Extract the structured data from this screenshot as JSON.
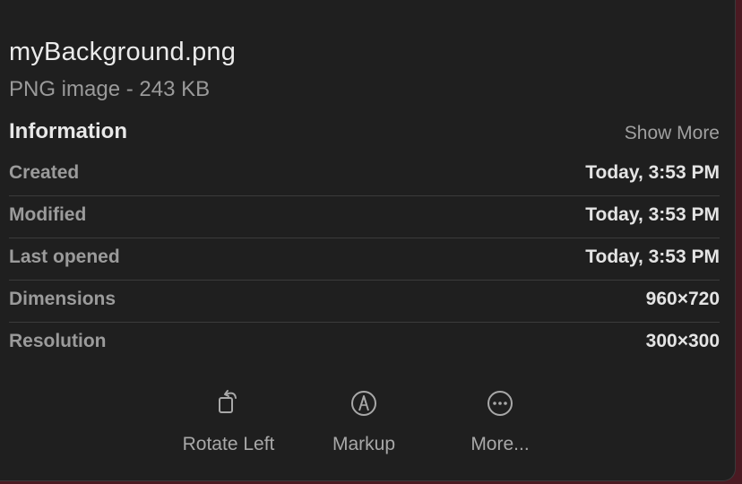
{
  "file": {
    "name": "myBackground.png",
    "kind": "PNG image - 243 KB"
  },
  "information": {
    "title": "Information",
    "show_more_label": "Show More",
    "rows": [
      {
        "label": "Created",
        "value": "Today, 3:53 PM"
      },
      {
        "label": "Modified",
        "value": "Today, 3:53 PM"
      },
      {
        "label": "Last opened",
        "value": "Today, 3:53 PM"
      },
      {
        "label": "Dimensions",
        "value": "960×720"
      },
      {
        "label": "Resolution",
        "value": "300×300"
      }
    ]
  },
  "actions": [
    {
      "label": "Rotate Left",
      "icon": "rotate-left-icon"
    },
    {
      "label": "Markup",
      "icon": "markup-icon"
    },
    {
      "label": "More...",
      "icon": "more-icon"
    }
  ],
  "colors": {
    "panel_background": "#1f1f1f",
    "primary_text": "#e6e6e6",
    "secondary_text": "#9b9b9b",
    "divider": "#3b3b3b"
  }
}
